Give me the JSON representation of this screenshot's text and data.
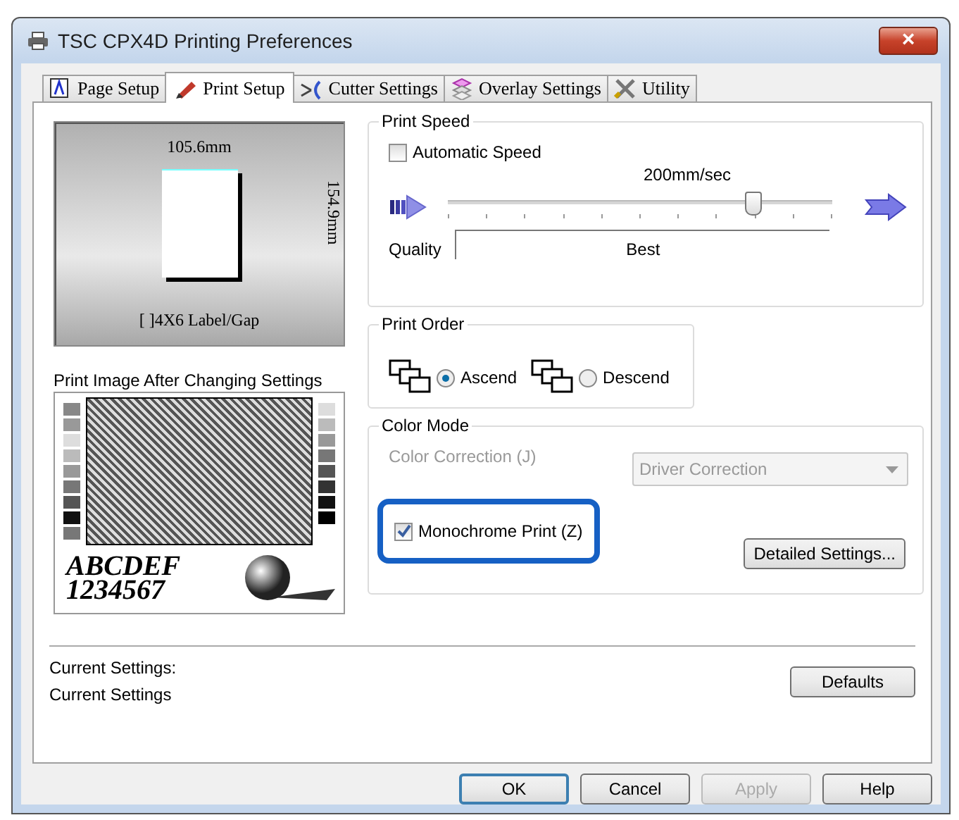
{
  "window": {
    "title": "TSC CPX4D Printing Preferences",
    "close": "×"
  },
  "tabs": [
    {
      "label": "Page Setup",
      "selected": false
    },
    {
      "label": "Print Setup",
      "selected": true
    },
    {
      "label": "Cutter Settings",
      "selected": false
    },
    {
      "label": "Overlay Settings",
      "selected": false
    },
    {
      "label": "Utility",
      "selected": false
    }
  ],
  "paper_preview": {
    "width": "105.6mm",
    "height": "154.9mm",
    "name": "[ ]4X6 Label/Gap"
  },
  "print_image": {
    "label": "Print Image After Changing Settings",
    "sample_text": [
      "ABCDEF",
      "1234567"
    ]
  },
  "print_speed": {
    "title": "Print Speed",
    "automatic": {
      "label": "Automatic Speed",
      "checked": false
    },
    "reading": "200mm/sec",
    "level": 0.79,
    "quality_label": "Quality",
    "quality_value": "Best"
  },
  "print_order": {
    "title": "Print Order",
    "options": [
      {
        "label": "Ascend",
        "selected": true
      },
      {
        "label": "Descend",
        "selected": false
      }
    ]
  },
  "color_mode": {
    "title": "Color Mode",
    "correction_label": "Color Correction (J)",
    "correction_value": "Driver Correction",
    "disabled": true,
    "monochrome": {
      "label": "Monochrome Print (Z)",
      "checked": true,
      "highlighted": true
    },
    "detail_button": "Detailed Settings..."
  },
  "current_settings": [
    "Current Settings:",
    "Current Settings"
  ],
  "defaults_button": "Defaults",
  "buttons": [
    {
      "label": "OK",
      "default": true,
      "disabled": false
    },
    {
      "label": "Cancel",
      "default": false,
      "disabled": false
    },
    {
      "label": "Apply",
      "default": false,
      "disabled": true
    },
    {
      "label": "Help",
      "default": false,
      "disabled": false
    }
  ]
}
